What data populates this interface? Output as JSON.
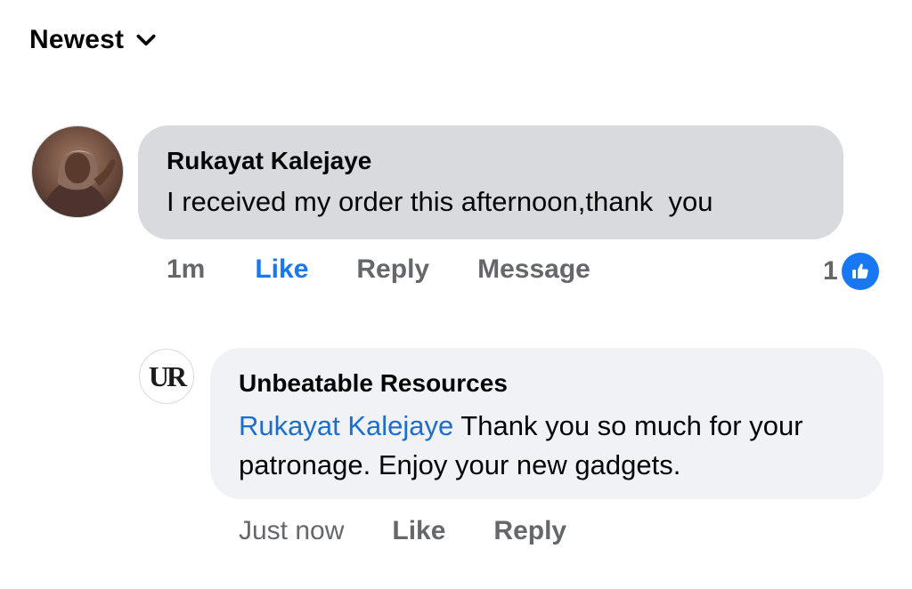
{
  "sort": {
    "label": "Newest",
    "icon": "chevron-down-icon"
  },
  "comments": [
    {
      "author": "Rukayat Kalejaye",
      "text": "I received my order this afternoon,thank  you",
      "time": "1m",
      "like_label": "Like",
      "reply_label": "Reply",
      "message_label": "Message",
      "reaction_count": "1",
      "reaction_icon": "thumbs-up-icon",
      "liked": true
    }
  ],
  "reply": {
    "author": "Unbeatable Resources",
    "avatar_text": "UR",
    "mention": "Rukayat Kalejaye",
    "text": " Thank you so much for your patronage. Enjoy your new gadgets.",
    "time": "Just now",
    "like_label": "Like",
    "reply_label": "Reply"
  },
  "colors": {
    "accent": "#1877f2",
    "mention": "#1b6ecf",
    "muted_text": "#65676b",
    "bubble": "#d8dade",
    "bubble_reply": "#f0f2f5"
  }
}
